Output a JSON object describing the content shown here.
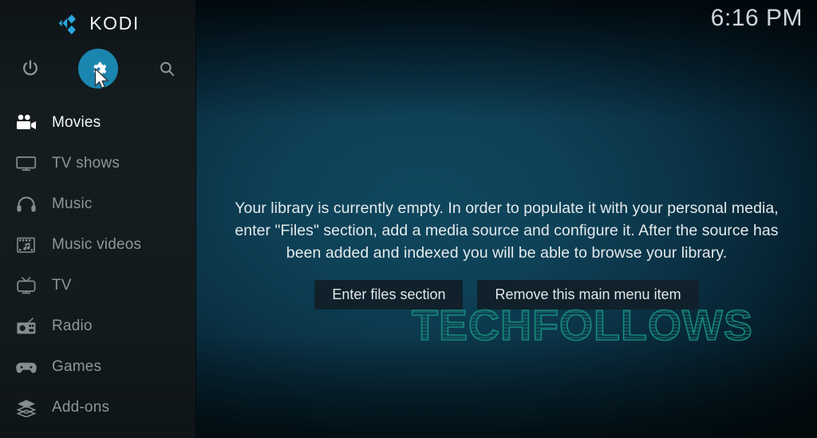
{
  "app": {
    "name": "KODI",
    "logo_icon": "kodi-logo-icon",
    "accent_color": "#1a86b0",
    "sidebar_bg": "#141c1f",
    "text_color": "#e3eaec"
  },
  "header": {
    "clock": "6:16 PM"
  },
  "top_actions": [
    {
      "name": "power",
      "label": "Power",
      "icon": "power-icon",
      "selected": false
    },
    {
      "name": "settings",
      "label": "Settings",
      "icon": "gear-icon",
      "selected": true
    },
    {
      "name": "search",
      "label": "Search",
      "icon": "search-icon",
      "selected": false
    }
  ],
  "sidebar": {
    "items": [
      {
        "label": "Movies",
        "icon": "movie-camera-icon",
        "active": true
      },
      {
        "label": "TV shows",
        "icon": "television-icon",
        "active": false
      },
      {
        "label": "Music",
        "icon": "headphones-icon",
        "active": false
      },
      {
        "label": "Music videos",
        "icon": "music-video-icon",
        "active": false
      },
      {
        "label": "TV",
        "icon": "tv-antenna-icon",
        "active": false
      },
      {
        "label": "Radio",
        "icon": "radio-icon",
        "active": false
      },
      {
        "label": "Games",
        "icon": "gamepad-icon",
        "active": false
      },
      {
        "label": "Add-ons",
        "icon": "addons-box-icon",
        "active": false
      }
    ]
  },
  "main": {
    "empty_message": "Your library is currently empty. In order to populate it with your personal media, enter \"Files\" section, add a media source and configure it. After the source has been added and indexed you will be able to browse your library.",
    "buttons": [
      {
        "label": "Enter files section"
      },
      {
        "label": "Remove this main menu item"
      }
    ]
  },
  "watermark": {
    "text": "TECHFOLLOWS",
    "color": "#17897a"
  }
}
